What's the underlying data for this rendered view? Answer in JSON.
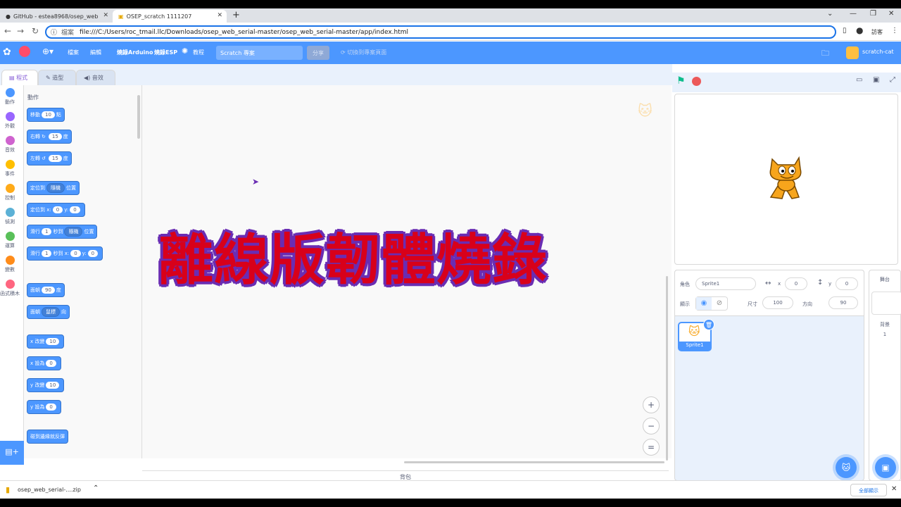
{
  "browser": {
    "tabs": [
      {
        "label": "GitHub - estea8968/osep_web"
      },
      {
        "label": "OSEP_scratch 1111207"
      }
    ],
    "new_tab": "+",
    "address": {
      "prefix": "檔案",
      "url": "file:///C:/Users/roc_tmail.llc/Downloads/osep_web_serial-master/osep_web_serial-master/app/index.html"
    },
    "profile": "訪客"
  },
  "menu": {
    "file": "檔案",
    "edit": "編輯",
    "arduino": "燒錄Arduino",
    "esp": "燒錄ESP",
    "tutorial": "教程",
    "project_title": "Scratch 專案",
    "share": "分享",
    "see_project_page": "切換到專案頁面",
    "user": "scratch-cat"
  },
  "editor_tabs": {
    "code": "程式",
    "costumes": "造型",
    "sounds": "音效"
  },
  "categories": [
    {
      "label": "動作",
      "color": "#4c97ff"
    },
    {
      "label": "外觀",
      "color": "#9966ff"
    },
    {
      "label": "音效",
      "color": "#cf63cf"
    },
    {
      "label": "事件",
      "color": "#ffbf00"
    },
    {
      "label": "控制",
      "color": "#ffab19"
    },
    {
      "label": "偵測",
      "color": "#5cb1d6"
    },
    {
      "label": "運算",
      "color": "#59c059"
    },
    {
      "label": "變數",
      "color": "#ff8c1a"
    },
    {
      "label": "函式積木",
      "color": "#ff6680"
    }
  ],
  "palette": {
    "heading": "動作",
    "blocks": {
      "move": {
        "pre": "移動",
        "val": "10",
        "post": "點"
      },
      "turn_right": {
        "pre": "右轉",
        "icon": "↻",
        "val": "15",
        "post": "度"
      },
      "turn_left": {
        "pre": "左轉",
        "icon": "↺",
        "val": "15",
        "post": "度"
      },
      "goto": {
        "pre": "定位到",
        "dd": "隨機",
        "post": "位置"
      },
      "goto_xy": {
        "pre": "定位到 x:",
        "x": "0",
        "ylabel": "y:",
        "y": "0"
      },
      "glide": {
        "pre": "滑行",
        "val": "1",
        "mid": "秒到",
        "dd": "隨機",
        "post": "位置"
      },
      "glide_xy": {
        "pre": "滑行",
        "val": "1",
        "mid": "秒到 x:",
        "x": "0",
        "ylabel": "y:",
        "y": "0"
      },
      "point_dir": {
        "pre": "面朝",
        "val": "90",
        "post": "度"
      },
      "point_towards": {
        "pre": "面朝",
        "dd": "鼠標",
        "post": "向"
      },
      "change_x": {
        "pre": "x 改變",
        "val": "10"
      },
      "set_x": {
        "pre": "x 設為",
        "val": "0"
      },
      "change_y": {
        "pre": "y 改變",
        "val": "10"
      },
      "set_y": {
        "pre": "y 設為",
        "val": "0"
      },
      "bounce": {
        "pre": "碰到邊緣就反彈"
      }
    }
  },
  "workspace": {
    "overlay_title": "離線版韌體燒錄",
    "zoom_in": "+",
    "zoom_out": "−",
    "zoom_reset": "=",
    "backpack": "背包"
  },
  "sprite_info": {
    "sprite_label": "角色",
    "sprite_name": "Sprite1",
    "x_label": "x",
    "x": "0",
    "y_label": "y",
    "y": "0",
    "show_label": "顯示",
    "size_label": "尺寸",
    "size": "100",
    "direction_label": "方向",
    "direction": "90"
  },
  "sprite_list": [
    {
      "name": "Sprite1"
    }
  ],
  "stage_panel": {
    "title": "舞台",
    "backdrops_label": "背景",
    "backdrops_count": "1"
  },
  "downloads": {
    "file": "osep_web_serial-....zip",
    "show_all": "全部顯示"
  }
}
